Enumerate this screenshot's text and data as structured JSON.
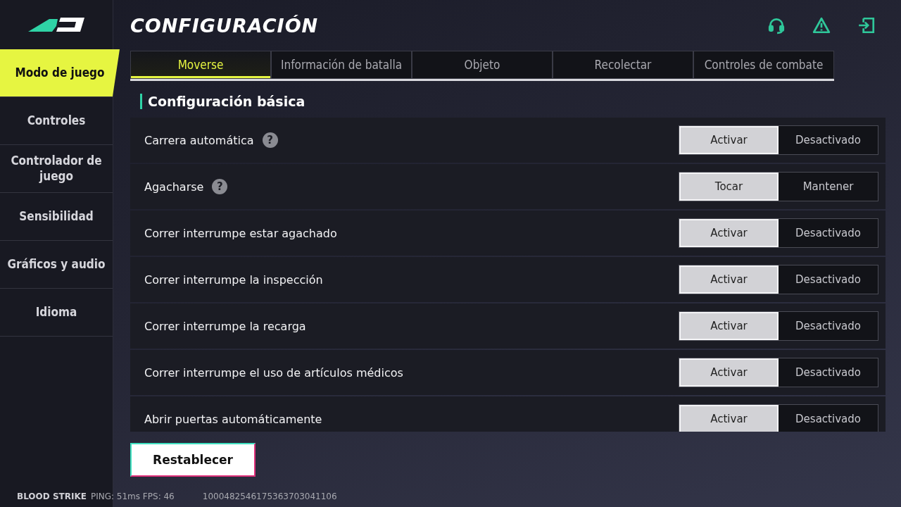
{
  "header": {
    "title": "CONFIGURACIÓN"
  },
  "sidebar": {
    "items": [
      {
        "label": "Modo de juego",
        "selected": true
      },
      {
        "label": "Controles",
        "selected": false
      },
      {
        "label": "Controlador de juego",
        "selected": false
      },
      {
        "label": "Sensibilidad",
        "selected": false
      },
      {
        "label": "Gráficos y audio",
        "selected": false
      },
      {
        "label": "Idioma",
        "selected": false
      }
    ]
  },
  "tabs": [
    {
      "label": "Moverse",
      "selected": true
    },
    {
      "label": "Información de batalla",
      "selected": false
    },
    {
      "label": "Objeto",
      "selected": false
    },
    {
      "label": "Recolectar",
      "selected": false
    },
    {
      "label": "Controles de combate",
      "selected": false
    }
  ],
  "section": {
    "title": "Configuración básica"
  },
  "settings": [
    {
      "label": "Carrera automática",
      "help": "?",
      "options": [
        {
          "label": "Activar",
          "selected": true
        },
        {
          "label": "Desactivado",
          "selected": false
        }
      ]
    },
    {
      "label": "Agacharse",
      "help": "?",
      "options": [
        {
          "label": "Tocar",
          "selected": true
        },
        {
          "label": "Mantener",
          "selected": false
        }
      ]
    },
    {
      "label": "Correr interrumpe estar agachado",
      "options": [
        {
          "label": "Activar",
          "selected": true
        },
        {
          "label": "Desactivado",
          "selected": false
        }
      ]
    },
    {
      "label": "Correr interrumpe la inspección",
      "options": [
        {
          "label": "Activar",
          "selected": true
        },
        {
          "label": "Desactivado",
          "selected": false
        }
      ]
    },
    {
      "label": "Correr interrumpe la recarga",
      "options": [
        {
          "label": "Activar",
          "selected": true
        },
        {
          "label": "Desactivado",
          "selected": false
        }
      ]
    },
    {
      "label": "Correr interrumpe el uso de artículos médicos",
      "options": [
        {
          "label": "Activar",
          "selected": true
        },
        {
          "label": "Desactivado",
          "selected": false
        }
      ]
    },
    {
      "label": "Abrir puertas automáticamente",
      "options": [
        {
          "label": "Activar",
          "selected": true
        },
        {
          "label": "Desactivado",
          "selected": false
        }
      ]
    }
  ],
  "reset_button": "Restablecer",
  "status_bar": {
    "game": "BLOOD STRIKE",
    "stats": "PING: 51ms FPS: 46",
    "id": "1000482546175363703041106"
  }
}
